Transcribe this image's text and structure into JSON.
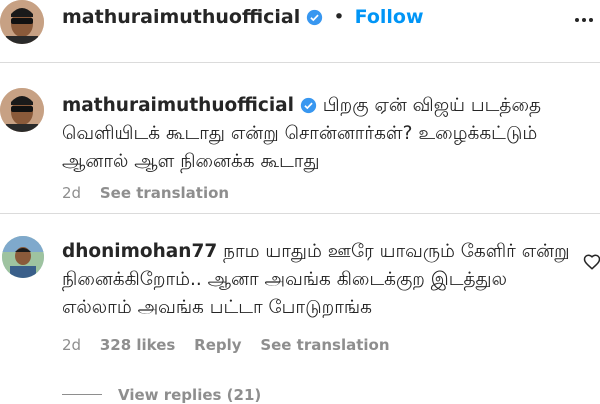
{
  "post_header": {
    "username": "mathuraimuthuofficial",
    "separator": "•",
    "follow_label": "Follow",
    "more_icon": "more-horizontal-icon"
  },
  "caption": {
    "username": "mathuraimuthuofficial",
    "text": "பிறகு ஏன் விஜய் படத்தை வெளியிடக் கூடாது என்று சொன்னார்கள்? உழைக்கட்டும் ஆனால் ஆள நினைக்க கூடாது",
    "time": "2d",
    "see_translation": "See translation"
  },
  "comment": {
    "username": "dhonimohan77",
    "text": "நாம யாதும் ஊரே யாவரும் கேளிர் என்று நினைக்கிறோம்.. ஆனா அவங்க கிடைக்குற இடத்துல எல்லாம் அவங்க பட்டா போடுறாங்க",
    "time": "2d",
    "likes": "328 likes",
    "reply": "Reply",
    "see_translation": "See translation",
    "view_replies": "View replies (21)"
  },
  "colors": {
    "link_blue": "#0095f6",
    "verified_blue": "#3897f0",
    "muted": "#8e8e8e",
    "text": "#262626"
  }
}
